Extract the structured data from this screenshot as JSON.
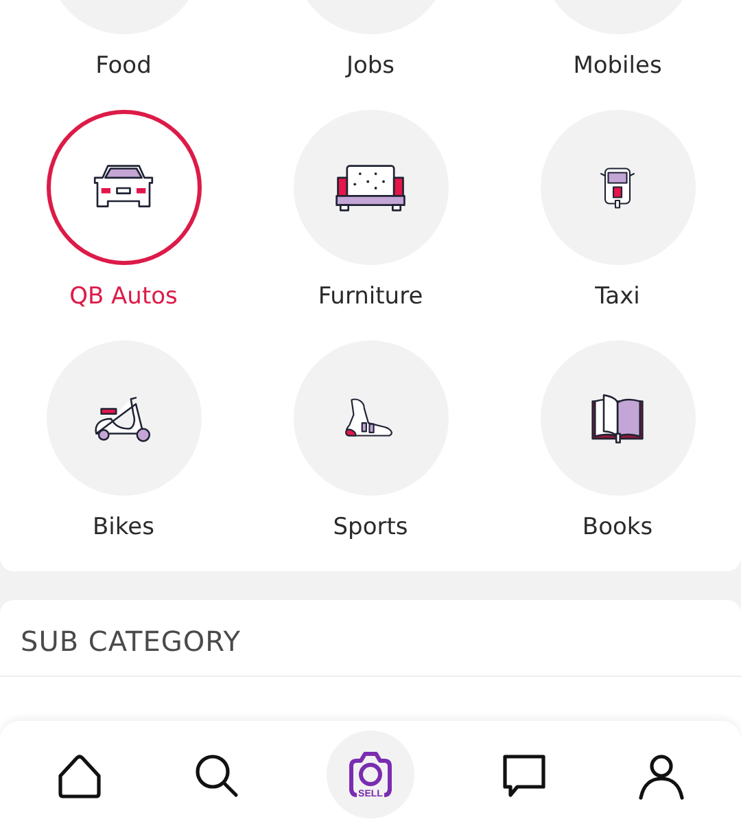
{
  "categories": [
    {
      "label": "Food",
      "selected": false
    },
    {
      "label": "Jobs",
      "selected": false
    },
    {
      "label": "Mobiles",
      "selected": false
    },
    {
      "label": "QB Autos",
      "selected": true
    },
    {
      "label": "Furniture",
      "selected": false
    },
    {
      "label": "Taxi",
      "selected": false
    },
    {
      "label": "Bikes",
      "selected": false
    },
    {
      "label": "Sports",
      "selected": false
    },
    {
      "label": "Books",
      "selected": false
    }
  ],
  "sub_category": {
    "title": "SUB CATEGORY"
  },
  "bottom_nav": [
    {
      "kind": "home"
    },
    {
      "kind": "search"
    },
    {
      "kind": "sell",
      "label": "SELL"
    },
    {
      "kind": "chat"
    },
    {
      "kind": "profile"
    }
  ]
}
